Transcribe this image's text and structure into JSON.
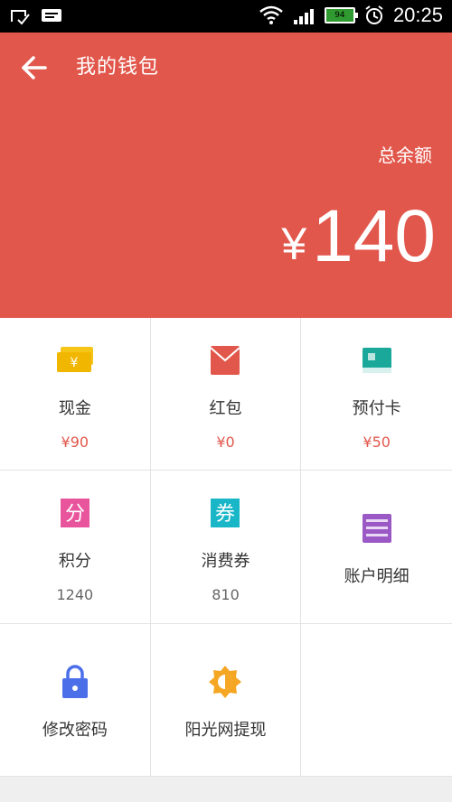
{
  "status_bar": {
    "battery": "94",
    "time": "20:25"
  },
  "header": {
    "title": "我的钱包",
    "balance_label": "总余额",
    "currency": "¥",
    "amount": "140",
    "accent": "#e2574c"
  },
  "grid": {
    "items": [
      {
        "label": "现金",
        "value": "¥90",
        "icon": "cash-icon"
      },
      {
        "label": "红包",
        "value": "¥0",
        "icon": "envelope-icon"
      },
      {
        "label": "预付卡",
        "value": "¥50",
        "icon": "card-icon"
      },
      {
        "label": "积分",
        "value": "1240",
        "icon": "points-icon"
      },
      {
        "label": "消费券",
        "value": "810",
        "icon": "coupon-icon"
      },
      {
        "label": "账户明细",
        "value": "",
        "icon": "account-detail-icon"
      },
      {
        "label": "修改密码",
        "value": "",
        "icon": "lock-icon"
      },
      {
        "label": "阳光网提现",
        "value": "",
        "icon": "sun-icon"
      }
    ]
  },
  "icon_glyphs": {
    "points": "分",
    "coupon": "券"
  }
}
